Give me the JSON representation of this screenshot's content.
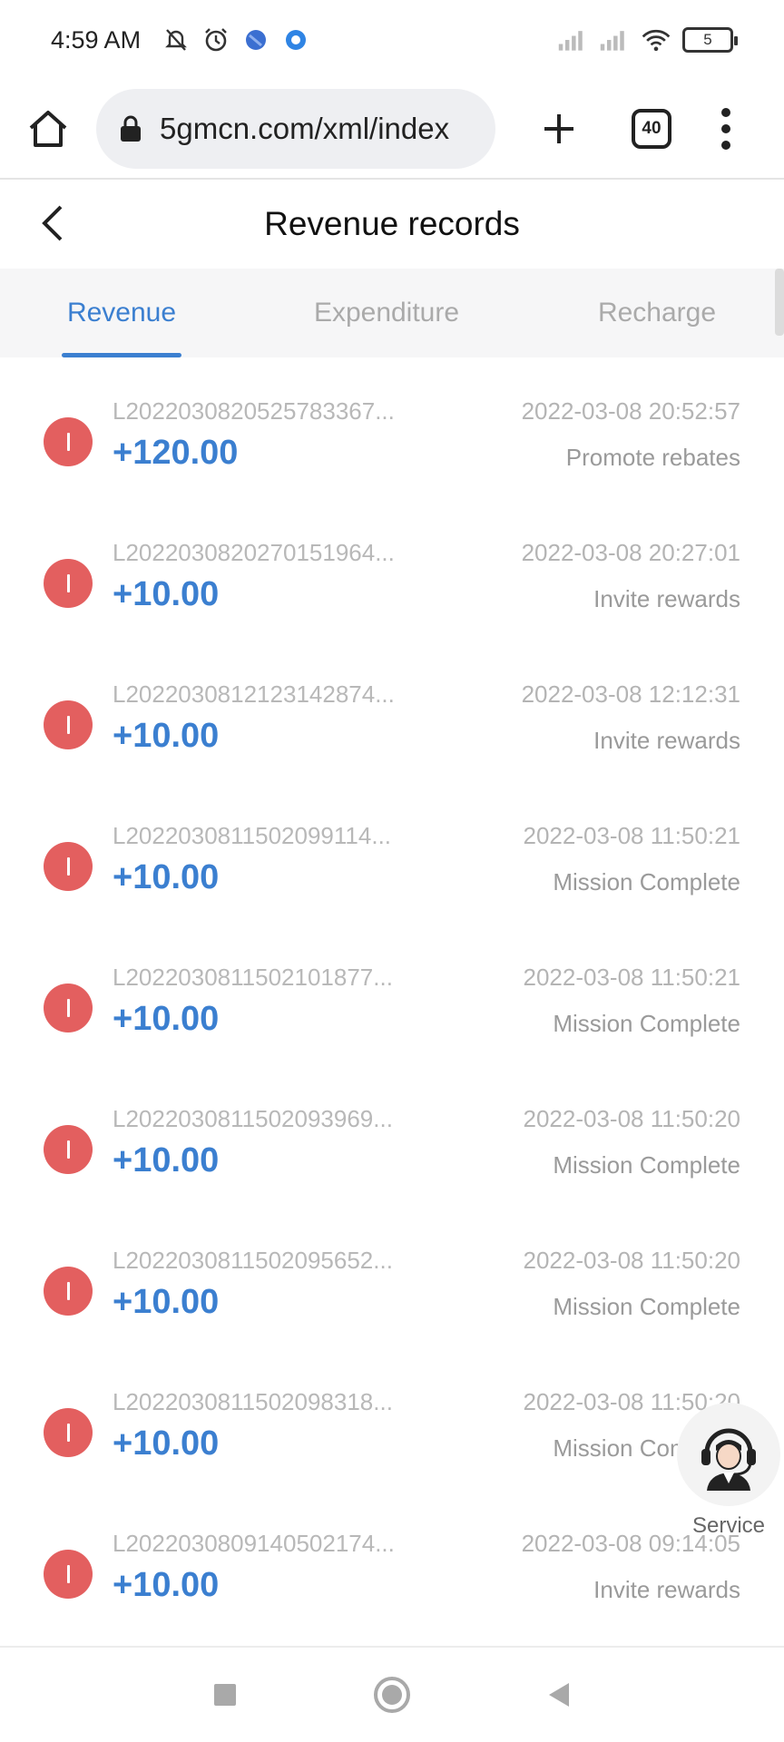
{
  "status_bar": {
    "time": "4:59 AM",
    "icons_left": [
      "bell-off-icon",
      "alarm-icon",
      "app-icon-blue",
      "app-icon-ring"
    ],
    "icons_right": [
      "signal-icon",
      "signal-icon",
      "wifi-icon"
    ],
    "battery": "5"
  },
  "browser": {
    "url": "5gmcn.com/xml/index",
    "tab_count": "40"
  },
  "header": {
    "title": "Revenue records"
  },
  "tabs": [
    {
      "label": "Revenue",
      "active": true
    },
    {
      "label": "Expenditure",
      "active": false
    },
    {
      "label": "Recharge",
      "active": false
    }
  ],
  "records": [
    {
      "id": "L2022030820525783367...",
      "amount": "+120.00",
      "time": "2022-03-08 20:52:57",
      "type": "Promote rebates"
    },
    {
      "id": "L2022030820270151964...",
      "amount": "+10.00",
      "time": "2022-03-08 20:27:01",
      "type": "Invite rewards"
    },
    {
      "id": "L2022030812123142874...",
      "amount": "+10.00",
      "time": "2022-03-08 12:12:31",
      "type": "Invite rewards"
    },
    {
      "id": "L2022030811502099114...",
      "amount": "+10.00",
      "time": "2022-03-08 11:50:21",
      "type": "Mission Complete"
    },
    {
      "id": "L2022030811502101877...",
      "amount": "+10.00",
      "time": "2022-03-08 11:50:21",
      "type": "Mission Complete"
    },
    {
      "id": "L2022030811502093969...",
      "amount": "+10.00",
      "time": "2022-03-08 11:50:20",
      "type": "Mission Complete"
    },
    {
      "id": "L2022030811502095652...",
      "amount": "+10.00",
      "time": "2022-03-08 11:50:20",
      "type": "Mission Complete"
    },
    {
      "id": "L2022030811502098318...",
      "amount": "+10.00",
      "time": "2022-03-08 11:50:20",
      "type": "Mission Complete"
    },
    {
      "id": "L2022030809140502174...",
      "amount": "+10.00",
      "time": "2022-03-08 09:14:05",
      "type": "Invite rewards"
    }
  ],
  "service": {
    "label": "Service"
  },
  "colors": {
    "accent": "#3b7fd0",
    "record_icon": "#e35f5f"
  }
}
